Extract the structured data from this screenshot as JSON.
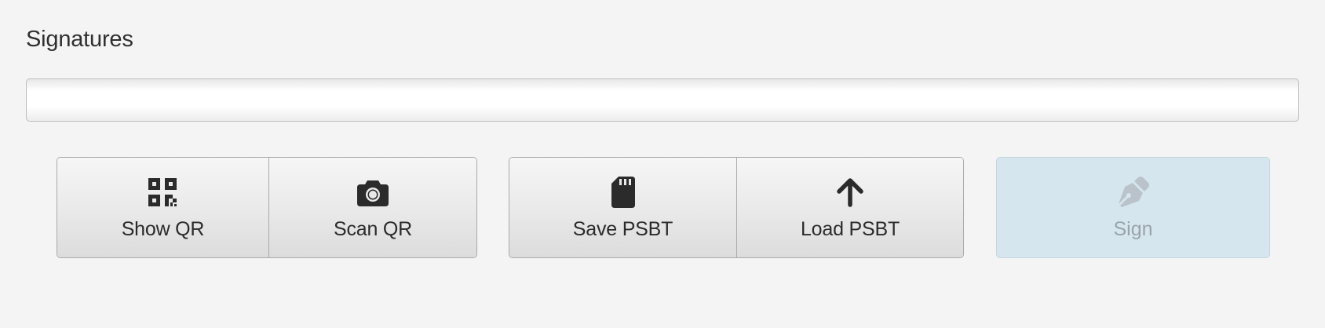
{
  "section": {
    "title": "Signatures"
  },
  "signatures_bar": {
    "value": ""
  },
  "qr_group": {
    "show_qr": {
      "label": "Show QR",
      "icon": "qrcode-icon"
    },
    "scan_qr": {
      "label": "Scan QR",
      "icon": "camera-icon"
    }
  },
  "psbt_group": {
    "save_psbt": {
      "label": "Save PSBT",
      "icon": "sd-card-icon"
    },
    "load_psbt": {
      "label": "Load PSBT",
      "icon": "arrow-up-icon"
    }
  },
  "sign": {
    "label": "Sign",
    "icon": "pen-nib-icon",
    "enabled": false
  },
  "colors": {
    "background": "#f4f4f4",
    "sign_disabled_bg": "#d6e6ef",
    "sign_disabled_text": "#9aa4aa",
    "icon_dark": "#2b2b2b"
  }
}
